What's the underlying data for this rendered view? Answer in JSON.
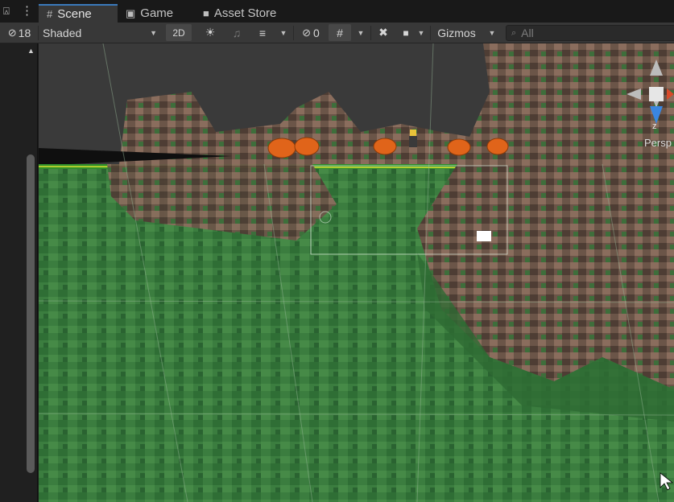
{
  "tabstrip": {
    "hidden_count": "18",
    "tabs": [
      {
        "label": "Scene",
        "icon": "hash-grid-icon"
      },
      {
        "label": "Game",
        "icon": "gamepad-icon"
      },
      {
        "label": "Asset Store",
        "icon": "shopping-bag-icon"
      }
    ]
  },
  "toolbar": {
    "shading_mode": "Shaded",
    "toggle_2d": "2D",
    "hidden_objects_count": "0",
    "gizmos_label": "Gizmos",
    "search_placeholder": "All"
  },
  "scene": {
    "camera_label": "Persp",
    "gizmo_axis": "z"
  },
  "colors": {
    "accent": "#3a79bb",
    "toolbar_bg": "#383838",
    "grass": "#3b7d3f",
    "sky": "#3a3a3a"
  }
}
